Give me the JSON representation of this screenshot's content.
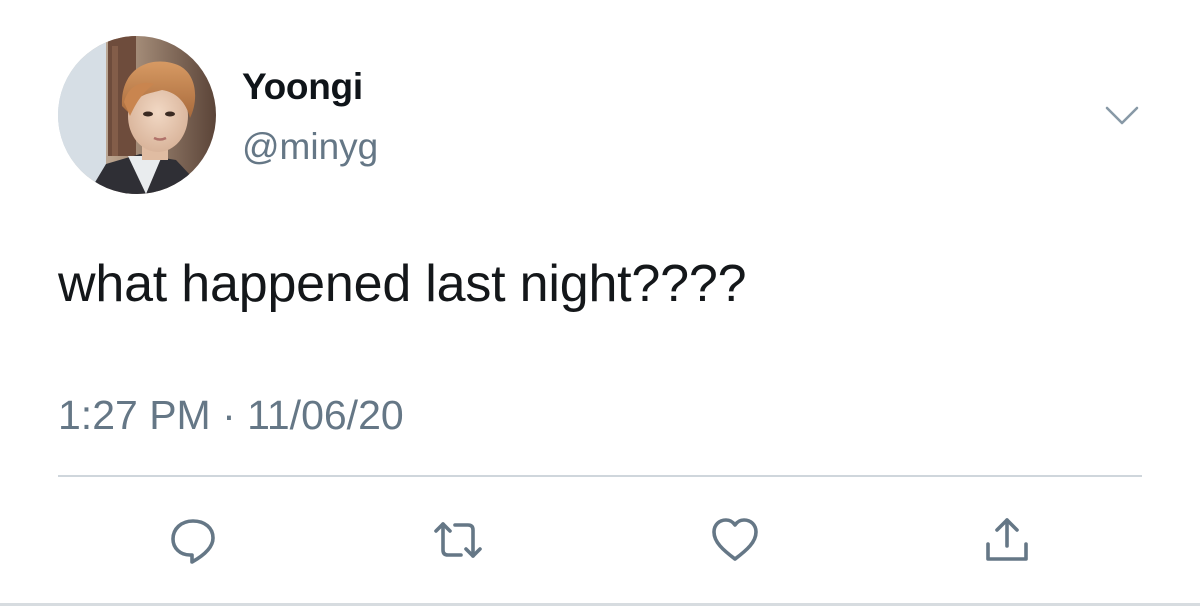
{
  "tweet": {
    "display_name": "Yoongi",
    "handle": "@minyg",
    "text": "what happened last night????",
    "timestamp": "1:27 PM · 11/06/20"
  },
  "icons": {
    "more": "chevron-down-icon",
    "reply": "reply-icon",
    "retweet": "retweet-icon",
    "like": "heart-icon",
    "share": "share-icon"
  },
  "colors": {
    "name": "#0f1419",
    "secondary": "#657786",
    "icon": "#657786",
    "divider": "#cfd6dc"
  }
}
